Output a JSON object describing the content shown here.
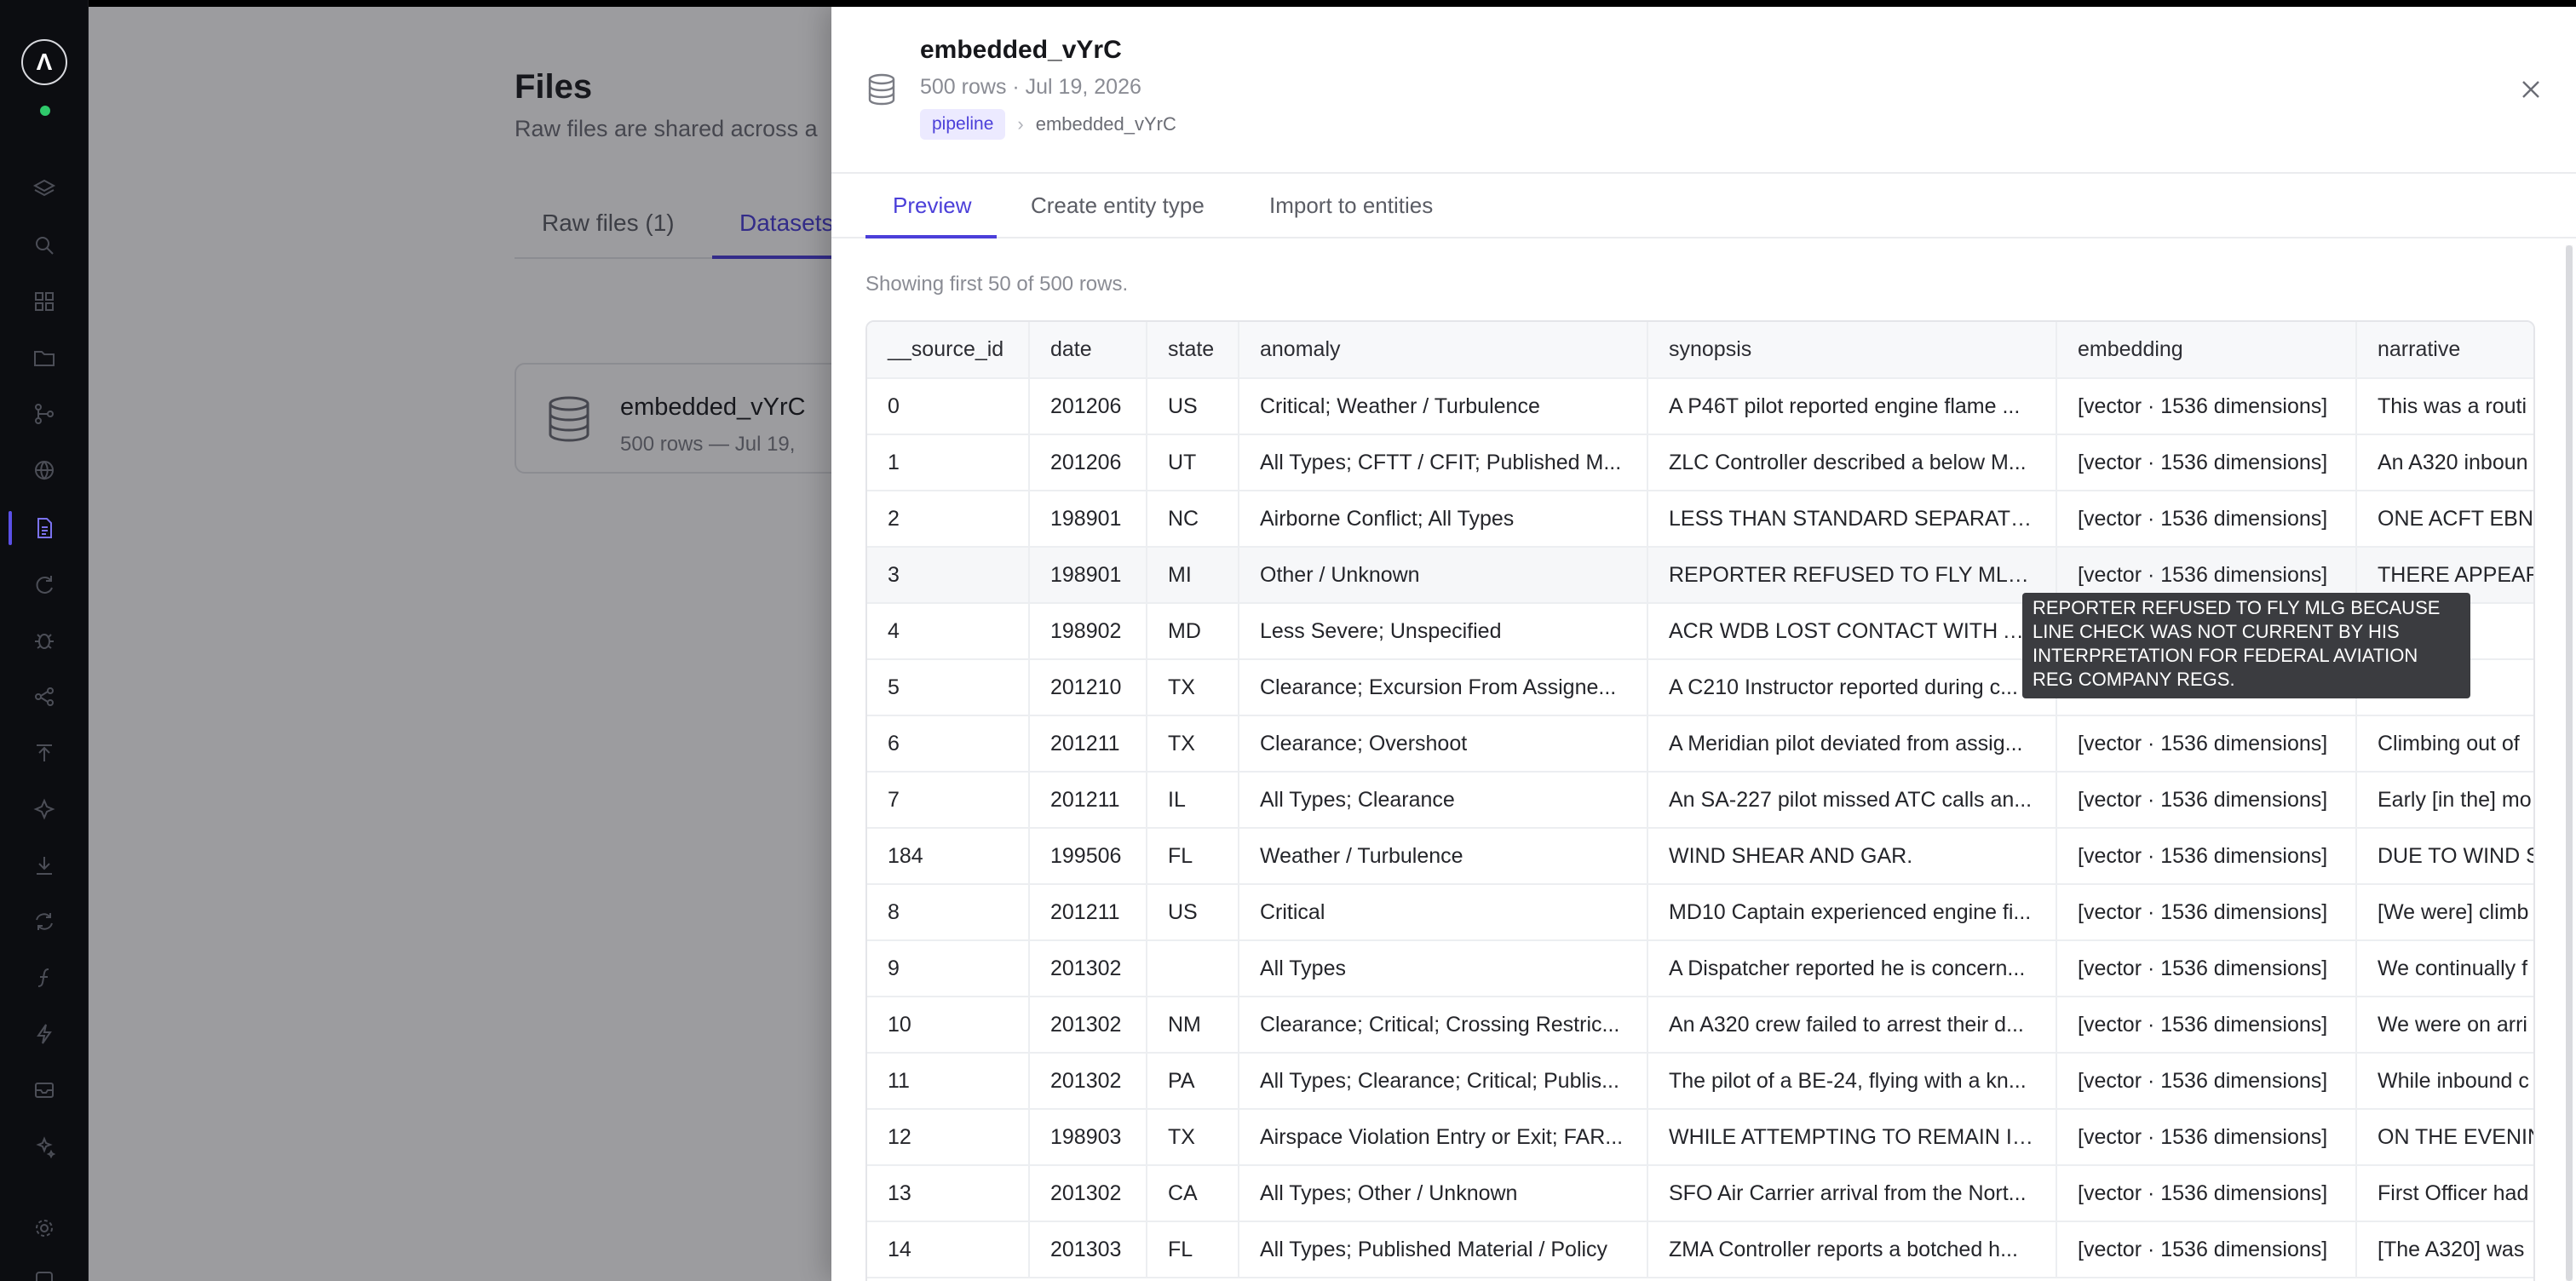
{
  "background": {
    "page_title": "Files",
    "page_subtitle": "Raw files are shared across a",
    "tabs": [
      "Raw files (1)",
      "Datasets"
    ],
    "card": {
      "name": "embedded_vYrC",
      "meta": "500 rows   —   Jul 19,"
    }
  },
  "drawer": {
    "title": "embedded_vYrC",
    "meta": "500 rows · Jul 19, 2026",
    "breadcrumb": {
      "pill": "pipeline",
      "leaf": "embedded_vYrC"
    },
    "tabs": [
      "Preview",
      "Create entity type",
      "Import to entities"
    ],
    "active_tab": "Preview",
    "showing_text": "Showing first 50 of 500 rows.",
    "table": {
      "columns": [
        "__source_id",
        "date",
        "state",
        "anomaly",
        "synopsis",
        "embedding",
        "narrative"
      ],
      "rows": [
        [
          "0",
          "201206",
          "US",
          "Critical; Weather / Turbulence",
          "A P46T pilot reported engine flame ...",
          "[vector · 1536 dimensions]",
          "This was a routi"
        ],
        [
          "1",
          "201206",
          "UT",
          "All Types; CFTT / CFIT; Published M...",
          "ZLC Controller described a below M...",
          "[vector · 1536 dimensions]",
          "An A320 inboun"
        ],
        [
          "2",
          "198901",
          "NC",
          "Airborne Conflict; All Types",
          "LESS THAN STANDARD SEPARATIO...",
          "[vector · 1536 dimensions]",
          "ONE ACFT EBND"
        ],
        [
          "3",
          "198901",
          "MI",
          "Other / Unknown",
          "REPORTER REFUSED TO FLY MLG B...",
          "[vector · 1536 dimensions]",
          "THERE APPEAR"
        ],
        [
          "4",
          "198902",
          "MD",
          "Less Severe; Unspecified",
          "ACR WDB LOST CONTACT WITH AR...",
          "[vector · 1536 dimensions]",
          "BI ARR"
        ],
        [
          "5",
          "201210",
          "TX",
          "Clearance; Excursion From Assigne...",
          "A C210 Instructor reported during c...",
          "[vector · 1536 dimensions]",
          "an IFR"
        ],
        [
          "6",
          "201211",
          "TX",
          "Clearance; Overshoot",
          "A Meridian pilot deviated from assig...",
          "[vector · 1536 dimensions]",
          "Climbing out of"
        ],
        [
          "7",
          "201211",
          "IL",
          "All Types; Clearance",
          "An SA-227 pilot missed ATC calls an...",
          "[vector · 1536 dimensions]",
          "Early [in the] mo"
        ],
        [
          "184",
          "199506",
          "FL",
          "Weather / Turbulence",
          "WIND SHEAR AND GAR.",
          "[vector · 1536 dimensions]",
          "DUE TO WIND S"
        ],
        [
          "8",
          "201211",
          "US",
          "Critical",
          "MD10 Captain experienced engine fi...",
          "[vector · 1536 dimensions]",
          "[We were] climb"
        ],
        [
          "9",
          "201302",
          "",
          "All Types",
          "A Dispatcher reported he is concern...",
          "[vector · 1536 dimensions]",
          "We continually f"
        ],
        [
          "10",
          "201302",
          "NM",
          "Clearance; Critical; Crossing Restric...",
          "An A320 crew failed to arrest their d...",
          "[vector · 1536 dimensions]",
          "We were on arri"
        ],
        [
          "11",
          "201302",
          "PA",
          "All Types; Clearance; Critical; Publis...",
          "The pilot of a BE-24, flying with a kn...",
          "[vector · 1536 dimensions]",
          "While inbound c"
        ],
        [
          "12",
          "198903",
          "TX",
          "Airspace Violation Entry or Exit; FAR...",
          "WHILE ATTEMPTING TO REMAIN IN ...",
          "[vector · 1536 dimensions]",
          "ON THE EVENIN"
        ],
        [
          "13",
          "201302",
          "CA",
          "All Types; Other / Unknown",
          "SFO Air Carrier arrival from the Nort...",
          "[vector · 1536 dimensions]",
          "First Officer had"
        ],
        [
          "14",
          "201303",
          "FL",
          "All Types; Published Material / Policy",
          "ZMA Controller reports a botched h...",
          "[vector · 1536 dimensions]",
          "[The A320] was"
        ]
      ]
    },
    "tooltip": "REPORTER REFUSED TO FLY MLG BECAUSE LINE CHECK WAS NOT CURRENT BY HIS INTERPRETATION FOR FEDERAL AVIATION REG COMPANY REGS."
  }
}
